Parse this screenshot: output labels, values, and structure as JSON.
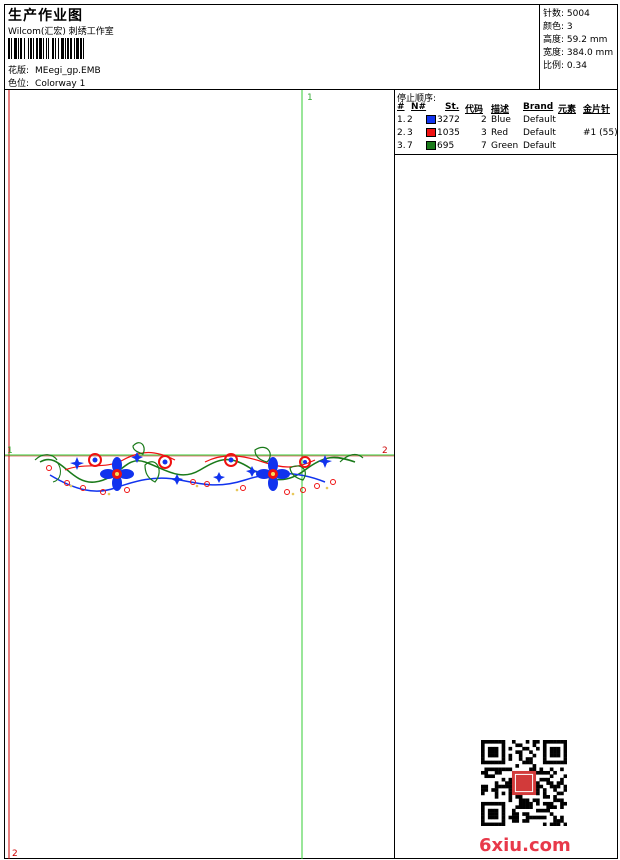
{
  "header": {
    "title": "生产作业图",
    "company": "Wilcom(汇宏) 刺绣工作室",
    "design_label": "花版:",
    "design_value": "MEegi_gp.EMB",
    "colorway_label": "色位:",
    "colorway_value": "Colorway 1"
  },
  "stats": [
    {
      "label": "针数:",
      "value": "5004"
    },
    {
      "label": "颜色:",
      "value": "3"
    },
    {
      "label": "高度:",
      "value": "59.2 mm"
    },
    {
      "label": "宽度:",
      "value": "384.0 mm"
    },
    {
      "label": "比例:",
      "value": "0.34"
    }
  ],
  "canvas": {
    "marker_top_1": "1",
    "marker_left_1": "1",
    "marker_right_2": "2",
    "marker_bottom_2": "2"
  },
  "stop_sequence": {
    "title": "停止顺序:",
    "headers": {
      "num": "#",
      "n": "N#",
      "st": "St.",
      "code": "代码",
      "desc": "描述",
      "brand": "Brand",
      "element": "元素",
      "sequin": "金片针"
    },
    "rows": [
      {
        "num": "1.",
        "n": "2",
        "color": "#1133ee",
        "st": "3272",
        "code": "2",
        "desc": "Blue",
        "brand": "Default",
        "sequin": ""
      },
      {
        "num": "2.",
        "n": "3",
        "color": "#ee1111",
        "st": "1035",
        "code": "3",
        "desc": "Red",
        "brand": "Default",
        "sequin": "#1 (55)"
      },
      {
        "num": "3.",
        "n": "7",
        "color": "#1a7a1a",
        "st": "695",
        "code": "7",
        "desc": "Green",
        "brand": "Default",
        "sequin": ""
      }
    ]
  },
  "watermark": "6xiu.com",
  "colors": {
    "guide_green": "#33cc33",
    "guide_red": "#cc0000",
    "thread_blue": "#1133ee",
    "thread_red": "#ee1111",
    "thread_green": "#1a7a1a"
  }
}
